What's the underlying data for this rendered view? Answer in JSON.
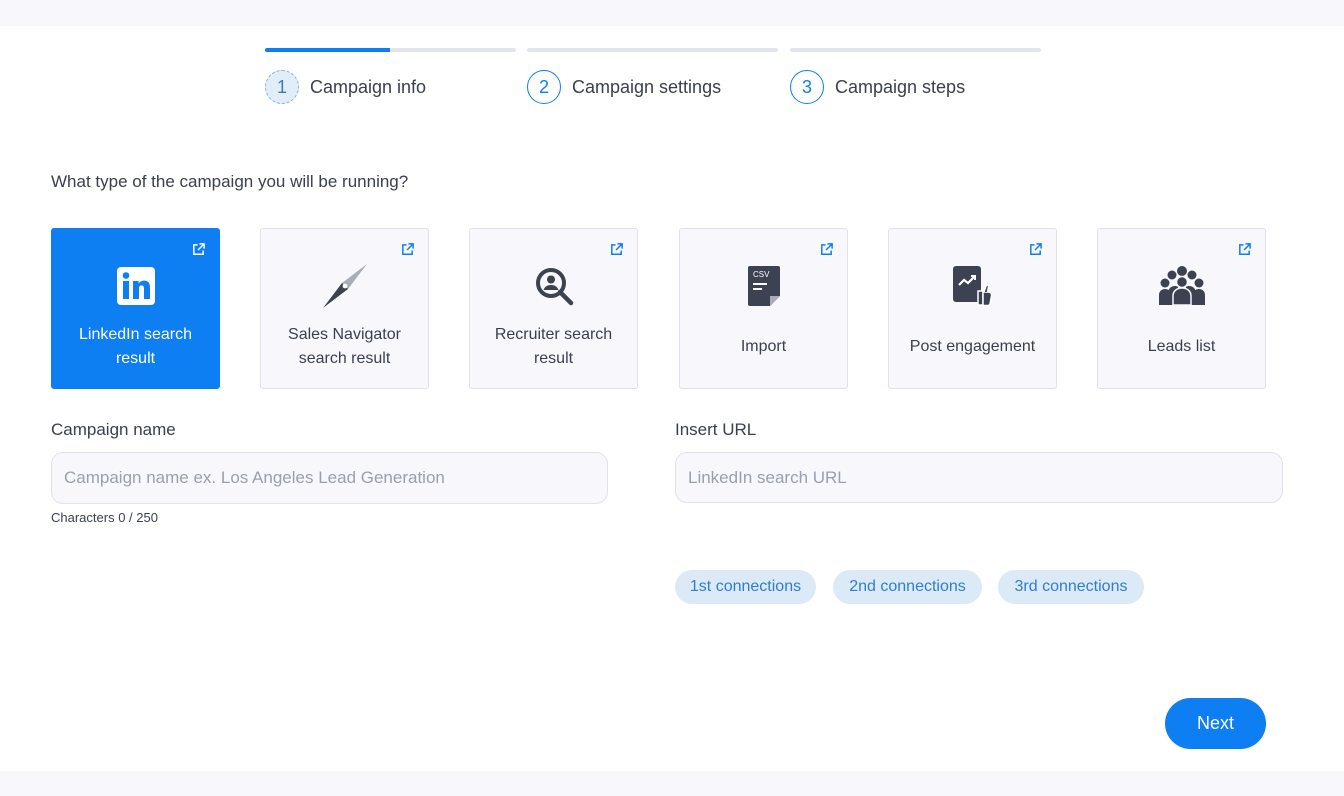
{
  "steps": [
    {
      "num": "1",
      "label": "Campaign info",
      "progress": 0.5
    },
    {
      "num": "2",
      "label": "Campaign settings",
      "progress": 0
    },
    {
      "num": "3",
      "label": "Campaign steps",
      "progress": 0
    }
  ],
  "question": "What type of the campaign you will be running?",
  "cards": [
    {
      "label": "LinkedIn search result",
      "icon": "linkedin-icon",
      "selected": true
    },
    {
      "label": "Sales Navigator search result",
      "icon": "compass-icon",
      "selected": false
    },
    {
      "label": "Recruiter search result",
      "icon": "recruiter-search-icon",
      "selected": false
    },
    {
      "label": "Import",
      "icon": "csv-file-icon",
      "icon_text": "CSV",
      "selected": false
    },
    {
      "label": "Post engagement",
      "icon": "post-engagement-icon",
      "selected": false
    },
    {
      "label": "Leads list",
      "icon": "people-group-icon",
      "selected": false
    }
  ],
  "campaign_name": {
    "label": "Campaign name",
    "placeholder": "Campaign name ex. Los Angeles Lead Generation",
    "value": "",
    "counter": "Characters 0 / 250"
  },
  "url": {
    "label": "Insert URL",
    "placeholder": "LinkedIn search URL",
    "value": ""
  },
  "chips": [
    "1st connections",
    "2nd connections",
    "3rd connections"
  ],
  "next_label": "Next",
  "colors": {
    "accent": "#0d7ff2",
    "chip_bg": "#dbeaf6",
    "card_bg": "#f8f8fc"
  }
}
